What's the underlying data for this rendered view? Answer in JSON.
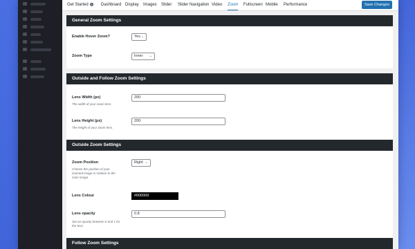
{
  "tabs": [
    {
      "label": "Get Started",
      "badge": "0"
    },
    {
      "label": "Dashboard"
    },
    {
      "label": "Display"
    },
    {
      "label": "Images"
    },
    {
      "label": "Slider"
    },
    {
      "label": "Slider Navigation"
    },
    {
      "label": "Video"
    },
    {
      "label": "Zoom"
    },
    {
      "label": "Fullscreen"
    },
    {
      "label": "Mobile"
    },
    {
      "label": "Performance"
    }
  ],
  "toolbar": {
    "save_label": "Save Changes"
  },
  "sections": {
    "general": {
      "title": "General Zoom Settings",
      "hover": {
        "label": "Enable Hover Zoom?",
        "value": "Yes"
      },
      "type": {
        "label": "Zoom Type",
        "value": "Inner"
      }
    },
    "outside_follow": {
      "title": "Outside and Follow Zoom Settings",
      "width": {
        "label": "Lens Width (px)",
        "desc": "The width of your zoom lens.",
        "value": "200"
      },
      "height": {
        "label": "Lens Height (px)",
        "desc": "The height of your zoom lens.",
        "value": "200"
      }
    },
    "outside": {
      "title": "Outside Zoom Settings",
      "position": {
        "label": "Zoom Position",
        "desc": "Choose the position of your zoomed image in relation to the main image.",
        "value": "Right"
      },
      "colour": {
        "label": "Lens Colour",
        "value": "#000000"
      },
      "opacity": {
        "label": "Lens opacity",
        "desc": "Set an opacity between 0 and 1 for the lens.",
        "value": "0.8"
      }
    },
    "follow": {
      "title": "Follow Zoom Settings"
    }
  },
  "colors": {
    "accent": "#2271b1",
    "section_header": "#23282d",
    "sidebar": "#1e1f26",
    "background": "#4a6fe3"
  }
}
